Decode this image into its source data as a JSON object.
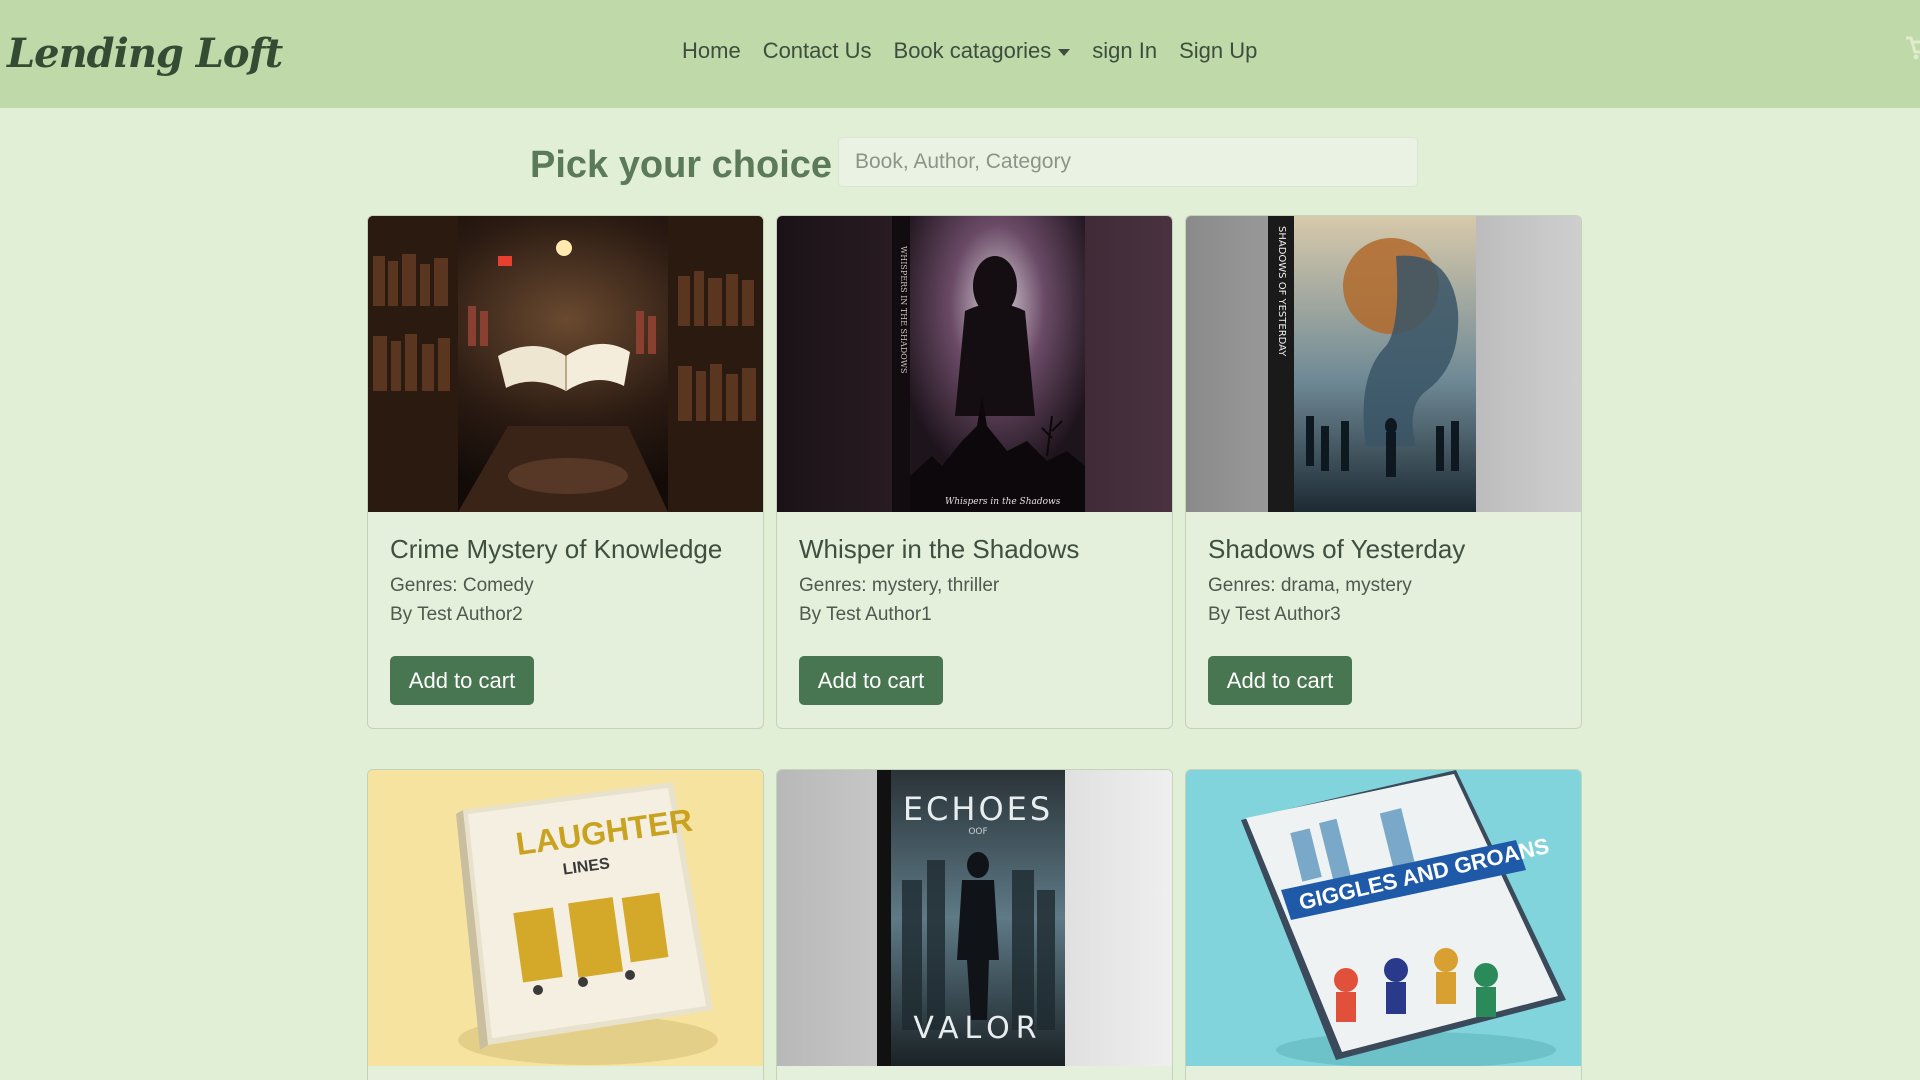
{
  "brand": {
    "name": "Lending Loft"
  },
  "nav": {
    "home": "Home",
    "contact": "Contact Us",
    "categories": "Book catagories",
    "sign_in": "sign In",
    "sign_up": "Sign Up"
  },
  "search": {
    "heading": "Pick your choice",
    "placeholder": "Book, Author, Category"
  },
  "books": [
    {
      "title": "Crime Mystery of Knowledge",
      "genres": "Genres: Comedy",
      "author": "By Test Author2",
      "button": "Add to cart"
    },
    {
      "title": "Whisper in the Shadows",
      "genres": "Genres: mystery, thriller",
      "author": "By Test Author1",
      "button": "Add to cart",
      "cover_text": "Whispers in the Shadows"
    },
    {
      "title": "Shadows of Yesterday",
      "genres": "Genres: drama, mystery",
      "author": "By Test Author3",
      "button": "Add to cart",
      "cover_text": "SHADOWS OF YESTERDAY"
    },
    {
      "cover_title": "LAUGHTER",
      "cover_sub": "LINES"
    },
    {
      "cover_title": "ECHOES",
      "cover_of": "OOF",
      "cover_bottom": "VALOR"
    },
    {
      "cover_title": "GIGGLES AND GROANS"
    }
  ],
  "colors": {
    "navbar": "#bfd9a8",
    "page_bg": "#e2efd7",
    "button": "#477650",
    "heading": "#5a7a5a"
  },
  "icons": {
    "cart": "cart-icon",
    "dropdown": "caret-down-icon"
  }
}
